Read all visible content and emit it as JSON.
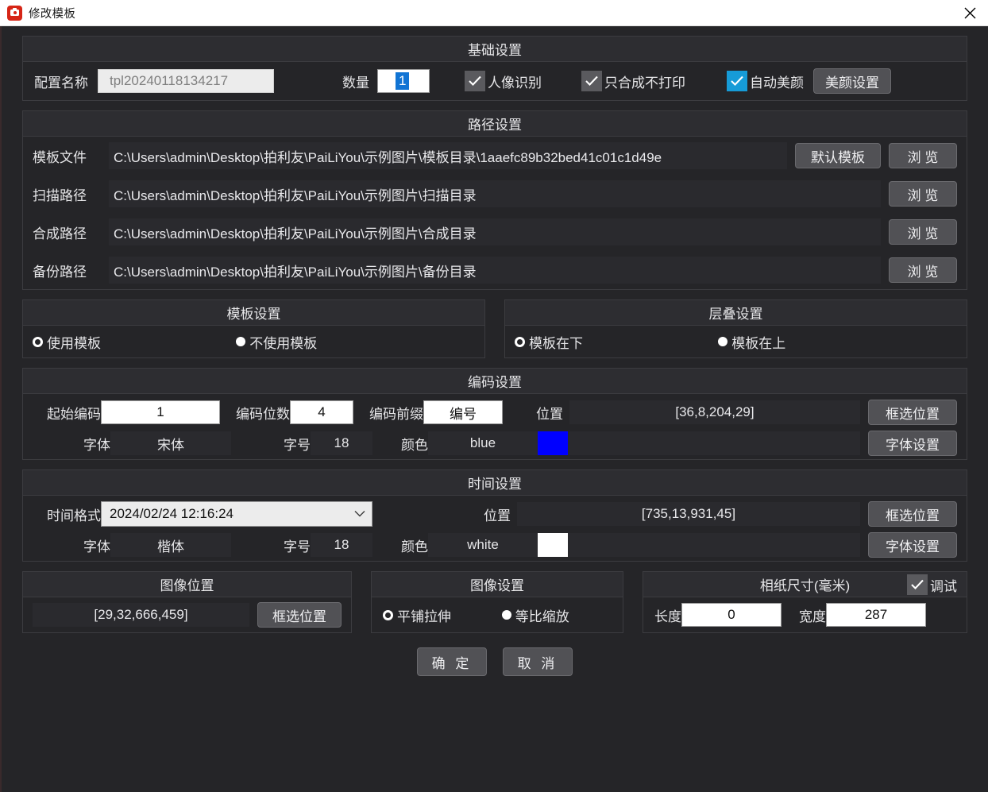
{
  "window": {
    "title": "修改模板",
    "icon": "camera-icon",
    "close_icon": "close-icon"
  },
  "basic": {
    "title": "基础设置",
    "config_name_label": "配置名称",
    "config_name_value": "tpl20240118134217",
    "quantity_label": "数量",
    "quantity_value": "1",
    "checkboxes": [
      {
        "label": "人像识别",
        "checked": true,
        "style": "gray"
      },
      {
        "label": "只合成不打印",
        "checked": true,
        "style": "gray"
      },
      {
        "label": "自动美颜",
        "checked": true,
        "style": "blue"
      }
    ],
    "beauty_button": "美颜设置"
  },
  "paths": {
    "title": "路径设置",
    "rows": [
      {
        "label": "模板文件",
        "value": "C:\\Users\\admin\\Desktop\\拍利友\\PaiLiYou\\示例图片\\模板目录\\1aaefc89b32bed41c01c1d49e",
        "default_button": "默认模板",
        "browse_button": "浏 览"
      },
      {
        "label": "扫描路径",
        "value": "C:\\Users\\admin\\Desktop\\拍利友\\PaiLiYou\\示例图片\\扫描目录",
        "browse_button": "浏 览"
      },
      {
        "label": "合成路径",
        "value": "C:\\Users\\admin\\Desktop\\拍利友\\PaiLiYou\\示例图片\\合成目录",
        "browse_button": "浏 览"
      },
      {
        "label": "备份路径",
        "value": "C:\\Users\\admin\\Desktop\\拍利友\\PaiLiYou\\示例图片\\备份目录",
        "browse_button": "浏 览"
      }
    ]
  },
  "template_settings": {
    "title": "模板设置",
    "option_a": "使用模板",
    "option_b": "不使用模板",
    "selected": "使用模板"
  },
  "layer_settings": {
    "title": "层叠设置",
    "option_a": "模板在下",
    "option_b": "模板在上",
    "selected": "模板在下"
  },
  "encoding": {
    "title": "编码设置",
    "start_label": "起始编码",
    "start_value": "1",
    "digits_label": "编码位数",
    "digits_value": "4",
    "prefix_label": "编码前缀",
    "prefix_value": "编号",
    "position_label": "位置",
    "position_value": "[36,8,204,29]",
    "position_button": "框选位置",
    "font_label": "字体",
    "font_value": "宋体",
    "size_label": "字号",
    "size_value": "18",
    "color_label": "颜色",
    "color_value": "blue",
    "color_hex": "#0000FF",
    "font_button": "字体设置"
  },
  "time": {
    "title": "时间设置",
    "format_label": "时间格式",
    "format_value": "2024/02/24 12:16:24",
    "position_label": "位置",
    "position_value": "[735,13,931,45]",
    "position_button": "框选位置",
    "font_label": "字体",
    "font_value": "楷体",
    "size_label": "字号",
    "size_value": "18",
    "color_label": "颜色",
    "color_value": "white",
    "color_hex": "#FFFFFF",
    "font_button": "字体设置"
  },
  "image_position": {
    "title": "图像位置",
    "value": "[29,32,666,459]",
    "button": "框选位置"
  },
  "image_settings": {
    "title": "图像设置",
    "option_a": "平铺拉伸",
    "option_b": "等比缩放",
    "selected": "平铺拉伸"
  },
  "paper": {
    "title": "相纸尺寸(毫米)",
    "debug_label": "调试",
    "debug_checked": true,
    "length_label": "长度",
    "length_value": "0",
    "width_label": "宽度",
    "width_value": "287"
  },
  "footer": {
    "ok": "确 定",
    "cancel": "取 消"
  }
}
